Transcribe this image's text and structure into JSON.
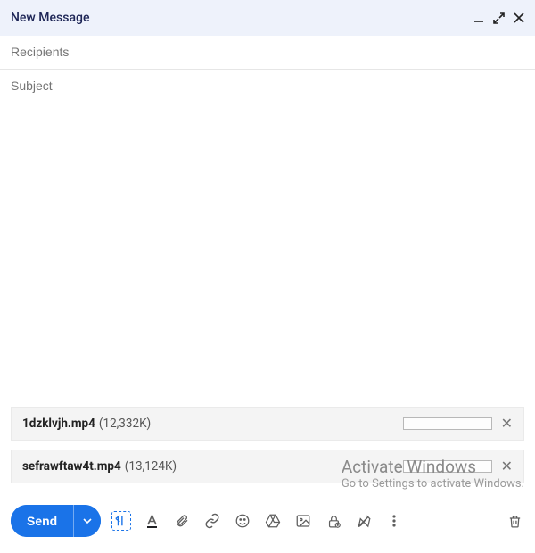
{
  "header": {
    "title": "New Message"
  },
  "fields": {
    "recipients_placeholder": "Recipients",
    "recipients_value": "",
    "subject_placeholder": "Subject",
    "subject_value": ""
  },
  "body": {
    "content": ""
  },
  "attachments": [
    {
      "name": "1dzklvjh.mp4",
      "size": "(12,332K)"
    },
    {
      "name": "sefrawftaw4t.mp4",
      "size": "(13,124K)"
    }
  ],
  "toolbar": {
    "send_label": "Send"
  },
  "watermark": {
    "line1": "Activate Windows",
    "line2": "Go to Settings to activate Windows."
  },
  "colors": {
    "accent": "#1a73e8",
    "titlebar_bg": "#eef2fb"
  }
}
